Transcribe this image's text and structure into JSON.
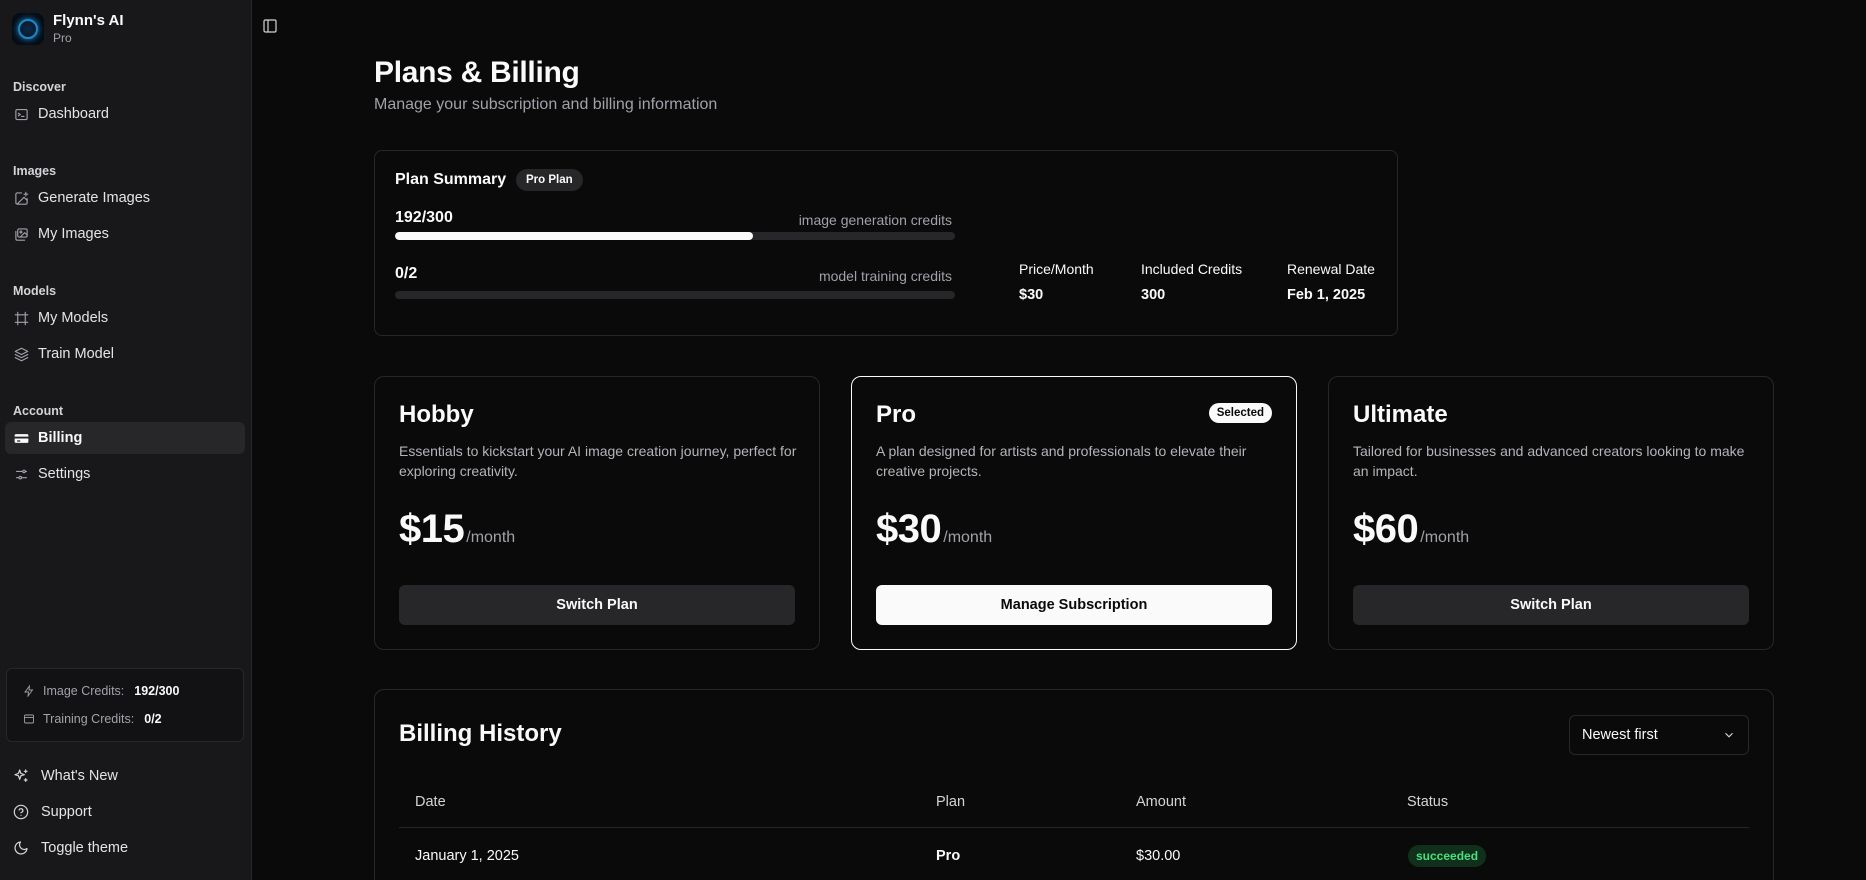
{
  "brand": {
    "name": "Flynn's AI",
    "plan": "Pro"
  },
  "sidebar": {
    "groups": [
      {
        "label": "Discover",
        "items": [
          {
            "label": "Dashboard",
            "icon": "terminal-icon"
          }
        ]
      },
      {
        "label": "Images",
        "items": [
          {
            "label": "Generate Images",
            "icon": "image-plus-icon"
          },
          {
            "label": "My Images",
            "icon": "images-icon"
          }
        ]
      },
      {
        "label": "Models",
        "items": [
          {
            "label": "My Models",
            "icon": "frame-icon"
          },
          {
            "label": "Train Model",
            "icon": "layers-icon"
          }
        ]
      },
      {
        "label": "Account",
        "items": [
          {
            "label": "Billing",
            "icon": "credit-card-icon",
            "active": true
          },
          {
            "label": "Settings",
            "icon": "sliders-icon"
          }
        ]
      }
    ],
    "credits": {
      "image_label": "Image Credits:",
      "image_value": "192/300",
      "training_label": "Training Credits:",
      "training_value": "0/2"
    },
    "footer": [
      {
        "label": "What's New",
        "icon": "sparkles-icon"
      },
      {
        "label": "Support",
        "icon": "help-circle-icon"
      },
      {
        "label": "Toggle theme",
        "icon": "moon-icon"
      }
    ]
  },
  "page": {
    "title": "Plans & Billing",
    "subtitle": "Manage your subscription and billing information"
  },
  "summary": {
    "title": "Plan Summary",
    "badge": "Pro Plan",
    "image_usage": {
      "value": "192/300",
      "label": "image generation credits",
      "fraction": 0.64
    },
    "training_usage": {
      "value": "0/2",
      "label": "model training credits",
      "fraction": 0
    },
    "stats": [
      {
        "label": "Price/Month",
        "value": "$30"
      },
      {
        "label": "Included Credits",
        "value": "300"
      },
      {
        "label": "Renewal Date",
        "value": "Feb 1, 2025"
      }
    ]
  },
  "plans": [
    {
      "name": "Hobby",
      "desc": "Essentials to kickstart your AI image creation journey, perfect for exploring creativity.",
      "price": "$15",
      "per": "/month",
      "button": "Switch Plan"
    },
    {
      "name": "Pro",
      "desc": "A plan designed for artists and professionals to elevate their creative projects.",
      "price": "$30",
      "per": "/month",
      "button": "Manage Subscription",
      "badge": "Selected"
    },
    {
      "name": "Ultimate",
      "desc": "Tailored for businesses and advanced creators looking to make an impact.",
      "price": "$60",
      "per": "/month",
      "button": "Switch Plan"
    }
  ],
  "history": {
    "title": "Billing History",
    "sort": "Newest first",
    "columns": [
      "Date",
      "Plan",
      "Amount",
      "Status"
    ],
    "rows": [
      {
        "date": "January 1, 2025",
        "plan": "Pro",
        "amount": "$30.00",
        "status": "succeeded"
      }
    ]
  },
  "colors": {
    "background": "#0a0a0a",
    "sidebar": "#18181b",
    "border": "#27272a",
    "success": "#4ade80"
  }
}
